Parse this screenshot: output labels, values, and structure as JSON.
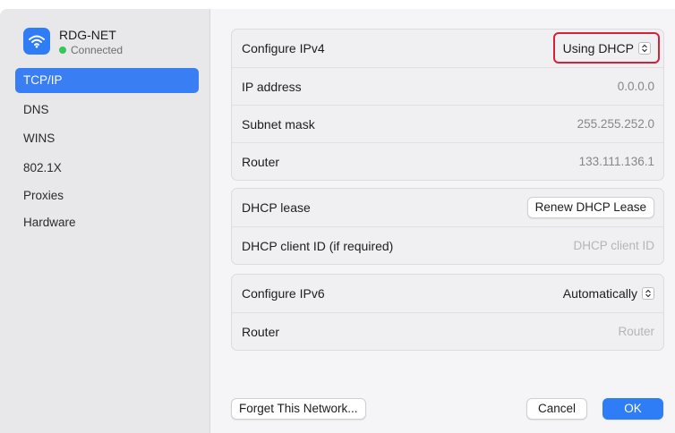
{
  "network": {
    "name": "RDG-NET",
    "status": "Connected",
    "icon": "wifi-icon",
    "accent": "#2f7df6"
  },
  "sidebar": {
    "items": [
      {
        "label": "TCP/IP",
        "active": true
      },
      {
        "label": "DNS",
        "active": false
      },
      {
        "label": "WINS",
        "active": false
      },
      {
        "label": "802.1X",
        "active": false
      },
      {
        "label": "Proxies",
        "active": false
      },
      {
        "label": "Hardware",
        "active": false
      }
    ]
  },
  "ipv4": {
    "configure_label": "Configure IPv4",
    "configure_value": "Using DHCP",
    "ip_label": "IP address",
    "ip_value": "0.0.0.0",
    "subnet_label": "Subnet mask",
    "subnet_value": "255.255.252.0",
    "router_label": "Router",
    "router_value": "133.111.136.1"
  },
  "dhcp": {
    "lease_label": "DHCP lease",
    "renew_button": "Renew DHCP Lease",
    "client_id_label": "DHCP client ID (if required)",
    "client_id_placeholder": "DHCP client ID"
  },
  "ipv6": {
    "configure_label": "Configure IPv6",
    "configure_value": "Automatically",
    "router_label": "Router",
    "router_placeholder": "Router"
  },
  "footer": {
    "forget_button": "Forget This Network...",
    "cancel_button": "Cancel",
    "ok_button": "OK"
  },
  "colors": {
    "selection": "#3a7ef3",
    "highlight_border": "#d61f38",
    "status_green": "#34c759"
  }
}
